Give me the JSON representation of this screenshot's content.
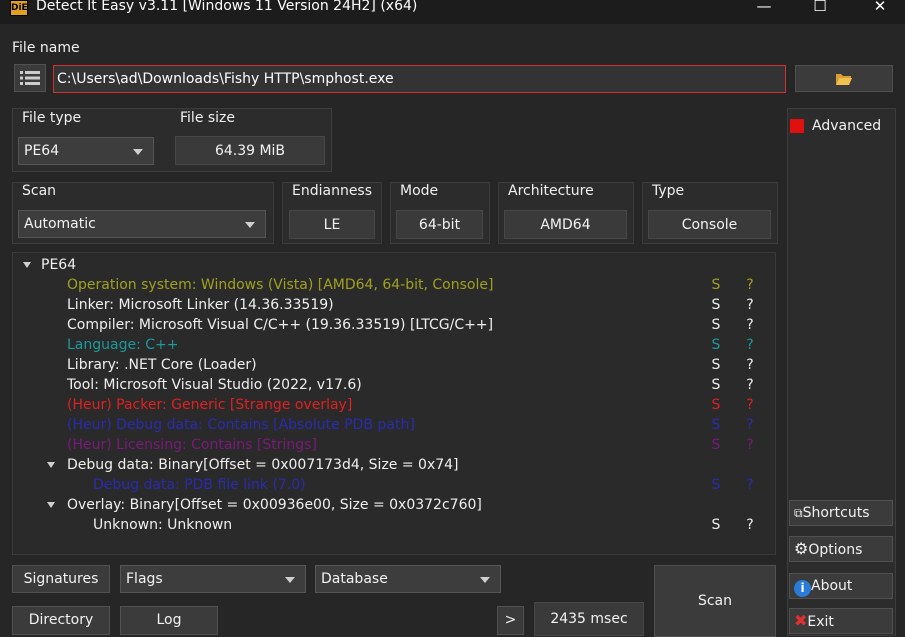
{
  "window": {
    "title": "Detect It Easy v3.11 [Windows 11 Version 24H2] (x64)",
    "icon_text": "DiE",
    "minimize": "—",
    "maximize": "☐",
    "close": "✕"
  },
  "file_name": {
    "label": "File name",
    "value": "C:\\Users\\ad\\Downloads\\Fishy HTTP\\smphost.exe"
  },
  "file_type": {
    "label": "File type",
    "value": "PE64"
  },
  "file_size": {
    "label": "File size",
    "value": "64.39 MiB"
  },
  "scan": {
    "label": "Scan",
    "value": "Automatic"
  },
  "endianness": {
    "label": "Endianness",
    "value": "LE"
  },
  "mode": {
    "label": "Mode",
    "value": "64-bit"
  },
  "architecture": {
    "label": "Architecture",
    "value": "AMD64"
  },
  "type": {
    "label": "Type",
    "value": "Console"
  },
  "advanced": {
    "label": "Advanced",
    "checked": true,
    "color": "#e01010"
  },
  "results": {
    "root": "PE64",
    "rows": [
      {
        "text": "Operation system: Windows (Vista) [AMD64, 64-bit, Console]",
        "s": "S",
        "q": "?",
        "color": "olive"
      },
      {
        "text": "Linker: Microsoft Linker (14.36.33519)",
        "s": "S",
        "q": "?",
        "color": "white"
      },
      {
        "text": "Compiler: Microsoft Visual C/C++ (19.36.33519) [LTCG/C++]",
        "s": "S",
        "q": "?",
        "color": "white"
      },
      {
        "text": "Language: C++",
        "s": "S",
        "q": "?",
        "color": "teal"
      },
      {
        "text": "Library: .NET Core (Loader)",
        "s": "S",
        "q": "?",
        "color": "white"
      },
      {
        "text": "Tool: Microsoft Visual Studio (2022, v17.6)",
        "s": "S",
        "q": "?",
        "color": "white"
      },
      {
        "text": "(Heur) Packer: Generic [Strange overlay]",
        "s": "S",
        "q": "?",
        "color": "red"
      },
      {
        "text": "(Heur) Debug data: Contains [Absolute PDB path]",
        "s": "S",
        "q": "?",
        "color": "blue"
      },
      {
        "text": "(Heur) Licensing: Contains [Strings]",
        "s": "S",
        "q": "?",
        "color": "purple"
      },
      {
        "text": "Debug data: Binary[Offset = 0x007173d4, Size = 0x74]",
        "s": "",
        "q": "",
        "color": "white"
      },
      {
        "text": "Debug data: PDB file link (7.0)",
        "s": "S",
        "q": "?",
        "color": "blue"
      },
      {
        "text": "Overlay: Binary[Offset = 0x00936e00, Size = 0x0372c760]",
        "s": "",
        "q": "",
        "color": "white"
      },
      {
        "text": "Unknown: Unknown",
        "s": "S",
        "q": "?",
        "color": "white"
      }
    ]
  },
  "bottom": {
    "signatures": "Signatures",
    "flags": "Flags",
    "database": "Database",
    "directory": "Directory",
    "log": "Log",
    "more": ">",
    "time": "2435 msec",
    "scan": "Scan"
  },
  "side": {
    "shortcuts": "Shortcuts",
    "options": "Options",
    "about": "About",
    "exit": "Exit"
  }
}
